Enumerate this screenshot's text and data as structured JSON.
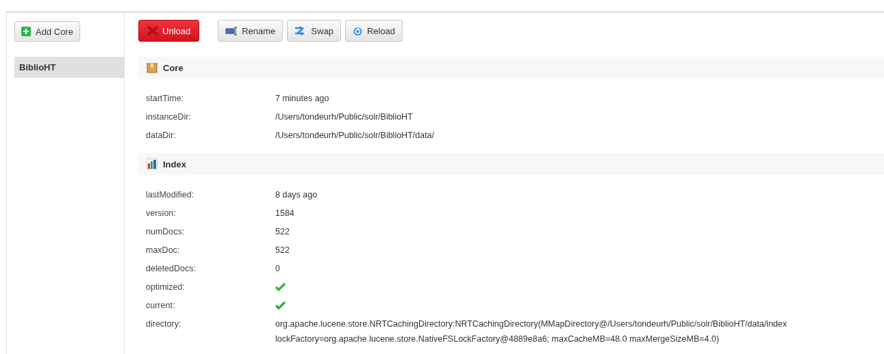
{
  "sidebar": {
    "add_button": "Add Core",
    "cores": [
      {
        "name": "BiblioHT",
        "selected": true
      }
    ]
  },
  "toolbar": [
    {
      "label": "Unload",
      "kind": "unload"
    },
    {
      "label": "Rename",
      "kind": "rename"
    },
    {
      "label": "Swap",
      "kind": "swap"
    },
    {
      "label": "Reload",
      "kind": "reload"
    }
  ],
  "sections": [
    {
      "title": "Core",
      "kind": "core",
      "rows": [
        {
          "label": "startTime:",
          "kind": "text",
          "value": "7 minutes ago"
        },
        {
          "label": "instanceDir:",
          "kind": "text",
          "value": "/Users/tondeurh/Public/solr/BiblioHT"
        },
        {
          "label": "dataDir:",
          "kind": "text",
          "value": "/Users/tondeurh/Public/solr/BiblioHT/data/"
        }
      ]
    },
    {
      "title": "Index",
      "kind": "index",
      "rows": [
        {
          "label": "lastModified:",
          "kind": "text",
          "value": "8 days ago"
        },
        {
          "label": "version:",
          "kind": "text",
          "value": "1584"
        },
        {
          "label": "numDocs:",
          "kind": "text",
          "value": "522"
        },
        {
          "label": "maxDoc:",
          "kind": "text",
          "value": "522"
        },
        {
          "label": "deletedDocs:",
          "kind": "text",
          "value": "0"
        },
        {
          "label": "optimized:",
          "kind": "flag",
          "checked": true
        },
        {
          "label": "current:",
          "kind": "flag",
          "checked": true
        },
        {
          "label": "directory:",
          "kind": "text",
          "value": "org.apache.lucene.store.NRTCachingDirectory:NRTCachingDirectory(MMapDirectory@/Users/tondeurh/Public/solr/BiblioHT/data/index lockFactory=org.apache.lucene.store.NativeFSLockFactory@4889e8a6; maxCacheMB=48.0 maxMergeSizeMB=4.0)"
        }
      ]
    }
  ]
}
